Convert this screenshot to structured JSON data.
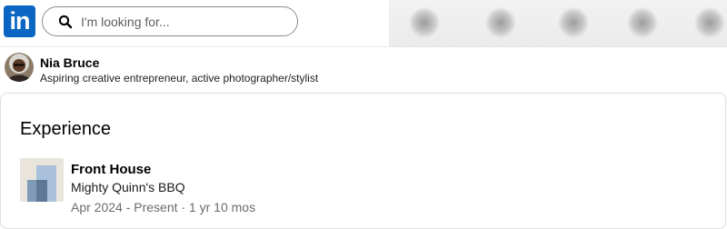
{
  "brand": {
    "logo_text": "in",
    "color": "#0a66c2"
  },
  "search": {
    "placeholder": "I'm looking for...",
    "value": ""
  },
  "profile": {
    "name": "Nia Bruce",
    "headline": "Aspiring creative entrepreneur, active photographer/stylist"
  },
  "experience": {
    "heading": "Experience",
    "items": [
      {
        "title": "Front House",
        "company": "Mighty Quinn's BBQ",
        "dates": "Apr 2024 - Present · 1 yr 10 mos"
      }
    ]
  },
  "icons": {
    "search": "search-icon",
    "company_logo": "building-logo"
  }
}
